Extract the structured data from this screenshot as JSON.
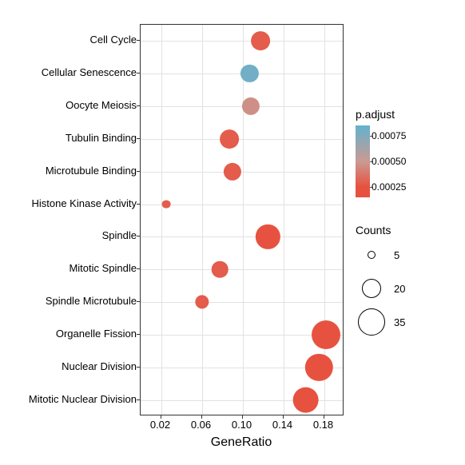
{
  "chart_data": {
    "type": "scatter",
    "xlabel": "GeneRatio",
    "ylabel": "",
    "xlim": [
      0.0,
      0.2
    ],
    "x_ticks": [
      0.02,
      0.06,
      0.1,
      0.14,
      0.18
    ],
    "categories": [
      "Cell Cycle",
      "Cellular Senescence",
      "Oocyte Meiosis",
      "Tubulin Binding",
      "Microtubule Binding",
      "Histone Kinase Activity",
      "Spindle",
      "Mitotic Spindle",
      "Spindle Microtubule",
      "Organelle Fission",
      "Nuclear Division",
      "Mitotic Nuclear Division"
    ],
    "points": [
      {
        "label": "Cell Cycle",
        "gene_ratio": 0.118,
        "counts": 22,
        "padjust": 0.0002
      },
      {
        "label": "Cellular Senescence",
        "gene_ratio": 0.107,
        "counts": 20,
        "padjust": 0.0008
      },
      {
        "label": "Oocyte Meiosis",
        "gene_ratio": 0.108,
        "counts": 20,
        "padjust": 0.00045
      },
      {
        "label": "Tubulin Binding",
        "gene_ratio": 0.087,
        "counts": 22,
        "padjust": 0.0002
      },
      {
        "label": "Microtubule Binding",
        "gene_ratio": 0.09,
        "counts": 20,
        "padjust": 0.0002
      },
      {
        "label": "Histone Kinase Activity",
        "gene_ratio": 0.025,
        "counts": 6,
        "padjust": 0.0002
      },
      {
        "label": "Spindle",
        "gene_ratio": 0.125,
        "counts": 30,
        "padjust": 0.00015
      },
      {
        "label": "Mitotic Spindle",
        "gene_ratio": 0.078,
        "counts": 18,
        "padjust": 0.0002
      },
      {
        "label": "Spindle Microtubule",
        "gene_ratio": 0.06,
        "counts": 14,
        "padjust": 0.0002
      },
      {
        "label": "Organelle Fission",
        "gene_ratio": 0.182,
        "counts": 37,
        "padjust": 0.00015
      },
      {
        "label": "Nuclear Division",
        "gene_ratio": 0.175,
        "counts": 35,
        "padjust": 0.00015
      },
      {
        "label": "Mitotic Nuclear Division",
        "gene_ratio": 0.162,
        "counts": 33,
        "padjust": 0.00015
      }
    ],
    "color_legend": {
      "title": "p.adjust",
      "ticks": [
        0.00025,
        0.0005,
        0.00075
      ],
      "min": 0.00015,
      "max": 0.00085
    },
    "size_legend": {
      "title": "Counts",
      "items": [
        5,
        20,
        35
      ]
    }
  },
  "axis": {
    "x_title": "GeneRatio",
    "x_tick_labels": [
      "0.02",
      "0.06",
      "0.10",
      "0.14",
      "0.18"
    ]
  },
  "legends": {
    "color_title": "p.adjust",
    "color_t1": "0.00075",
    "color_t2": "0.00050",
    "color_t3": "0.00025",
    "size_title": "Counts",
    "size_v1": "5",
    "size_v2": "20",
    "size_v3": "35"
  },
  "ylab": {
    "0": "Cell Cycle",
    "1": "Cellular Senescence",
    "2": "Oocyte Meiosis",
    "3": "Tubulin Binding",
    "4": "Microtubule Binding",
    "5": "Histone Kinase Activity",
    "6": "Spindle",
    "7": "Mitotic Spindle",
    "8": "Spindle Microtubule",
    "9": "Organelle Fission",
    "10": "Nuclear Division",
    "11": "Mitotic Nuclear Division"
  }
}
